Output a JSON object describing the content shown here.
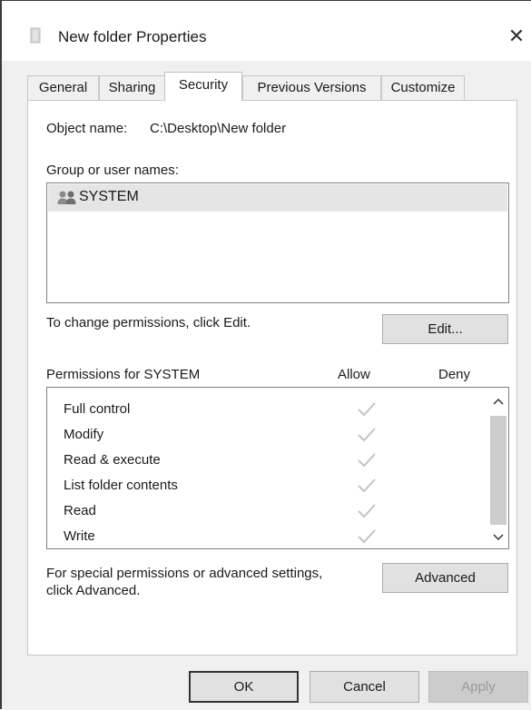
{
  "window": {
    "title": "New folder Properties",
    "close_glyph": "✕"
  },
  "tabs": [
    {
      "label": "General"
    },
    {
      "label": "Sharing"
    },
    {
      "label": "Security",
      "active": true
    },
    {
      "label": "Previous Versions"
    },
    {
      "label": "Customize"
    }
  ],
  "security": {
    "object_name_label": "Object name:",
    "object_name_value": "C:\\Desktop\\New folder",
    "group_label": "Group or user names:",
    "users": [
      {
        "name": "SYSTEM",
        "icon": "users-icon",
        "selected": true
      }
    ],
    "change_hint": "To change permissions, click Edit.",
    "edit_button": "Edit...",
    "permissions_label": "Permissions for SYSTEM",
    "allow_header": "Allow",
    "deny_header": "Deny",
    "permissions": [
      {
        "name": "Full control",
        "allow": true,
        "deny": false
      },
      {
        "name": "Modify",
        "allow": true,
        "deny": false
      },
      {
        "name": "Read & execute",
        "allow": true,
        "deny": false
      },
      {
        "name": "List folder contents",
        "allow": true,
        "deny": false
      },
      {
        "name": "Read",
        "allow": true,
        "deny": false
      },
      {
        "name": "Write",
        "allow": true,
        "deny": false
      }
    ],
    "advanced_hint_line1": "For special permissions or advanced settings,",
    "advanced_hint_line2": "click Advanced.",
    "advanced_button": "Advanced"
  },
  "footer": {
    "ok": "OK",
    "cancel": "Cancel",
    "apply": "Apply"
  },
  "colors": {
    "checkmark": "#c4c4c4",
    "selection": "#e5e5e5"
  }
}
